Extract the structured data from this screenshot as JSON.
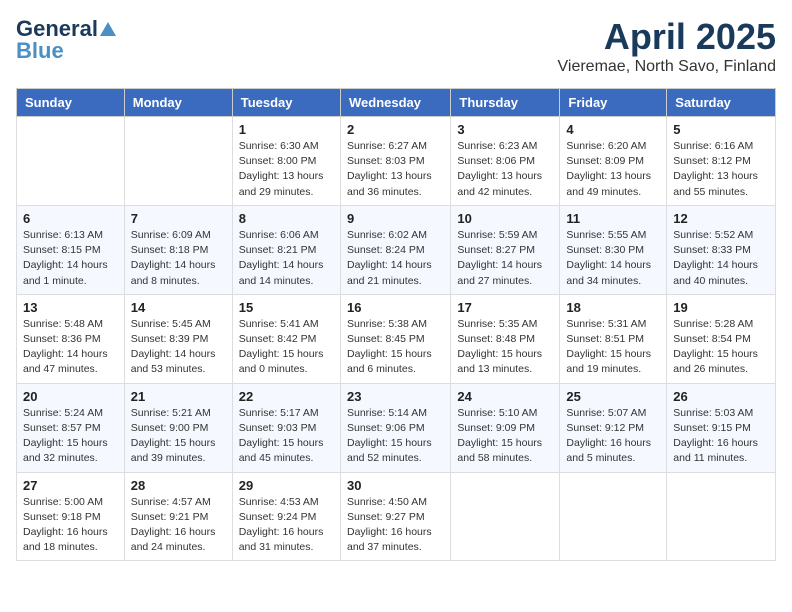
{
  "header": {
    "logo_general": "General",
    "logo_blue": "Blue",
    "month_title": "April 2025",
    "location": "Vieremae, North Savo, Finland"
  },
  "weekdays": [
    "Sunday",
    "Monday",
    "Tuesday",
    "Wednesday",
    "Thursday",
    "Friday",
    "Saturday"
  ],
  "weeks": [
    [
      {
        "day": "",
        "info": ""
      },
      {
        "day": "",
        "info": ""
      },
      {
        "day": "1",
        "info": "Sunrise: 6:30 AM\nSunset: 8:00 PM\nDaylight: 13 hours and 29 minutes."
      },
      {
        "day": "2",
        "info": "Sunrise: 6:27 AM\nSunset: 8:03 PM\nDaylight: 13 hours and 36 minutes."
      },
      {
        "day": "3",
        "info": "Sunrise: 6:23 AM\nSunset: 8:06 PM\nDaylight: 13 hours and 42 minutes."
      },
      {
        "day": "4",
        "info": "Sunrise: 6:20 AM\nSunset: 8:09 PM\nDaylight: 13 hours and 49 minutes."
      },
      {
        "day": "5",
        "info": "Sunrise: 6:16 AM\nSunset: 8:12 PM\nDaylight: 13 hours and 55 minutes."
      }
    ],
    [
      {
        "day": "6",
        "info": "Sunrise: 6:13 AM\nSunset: 8:15 PM\nDaylight: 14 hours and 1 minute."
      },
      {
        "day": "7",
        "info": "Sunrise: 6:09 AM\nSunset: 8:18 PM\nDaylight: 14 hours and 8 minutes."
      },
      {
        "day": "8",
        "info": "Sunrise: 6:06 AM\nSunset: 8:21 PM\nDaylight: 14 hours and 14 minutes."
      },
      {
        "day": "9",
        "info": "Sunrise: 6:02 AM\nSunset: 8:24 PM\nDaylight: 14 hours and 21 minutes."
      },
      {
        "day": "10",
        "info": "Sunrise: 5:59 AM\nSunset: 8:27 PM\nDaylight: 14 hours and 27 minutes."
      },
      {
        "day": "11",
        "info": "Sunrise: 5:55 AM\nSunset: 8:30 PM\nDaylight: 14 hours and 34 minutes."
      },
      {
        "day": "12",
        "info": "Sunrise: 5:52 AM\nSunset: 8:33 PM\nDaylight: 14 hours and 40 minutes."
      }
    ],
    [
      {
        "day": "13",
        "info": "Sunrise: 5:48 AM\nSunset: 8:36 PM\nDaylight: 14 hours and 47 minutes."
      },
      {
        "day": "14",
        "info": "Sunrise: 5:45 AM\nSunset: 8:39 PM\nDaylight: 14 hours and 53 minutes."
      },
      {
        "day": "15",
        "info": "Sunrise: 5:41 AM\nSunset: 8:42 PM\nDaylight: 15 hours and 0 minutes."
      },
      {
        "day": "16",
        "info": "Sunrise: 5:38 AM\nSunset: 8:45 PM\nDaylight: 15 hours and 6 minutes."
      },
      {
        "day": "17",
        "info": "Sunrise: 5:35 AM\nSunset: 8:48 PM\nDaylight: 15 hours and 13 minutes."
      },
      {
        "day": "18",
        "info": "Sunrise: 5:31 AM\nSunset: 8:51 PM\nDaylight: 15 hours and 19 minutes."
      },
      {
        "day": "19",
        "info": "Sunrise: 5:28 AM\nSunset: 8:54 PM\nDaylight: 15 hours and 26 minutes."
      }
    ],
    [
      {
        "day": "20",
        "info": "Sunrise: 5:24 AM\nSunset: 8:57 PM\nDaylight: 15 hours and 32 minutes."
      },
      {
        "day": "21",
        "info": "Sunrise: 5:21 AM\nSunset: 9:00 PM\nDaylight: 15 hours and 39 minutes."
      },
      {
        "day": "22",
        "info": "Sunrise: 5:17 AM\nSunset: 9:03 PM\nDaylight: 15 hours and 45 minutes."
      },
      {
        "day": "23",
        "info": "Sunrise: 5:14 AM\nSunset: 9:06 PM\nDaylight: 15 hours and 52 minutes."
      },
      {
        "day": "24",
        "info": "Sunrise: 5:10 AM\nSunset: 9:09 PM\nDaylight: 15 hours and 58 minutes."
      },
      {
        "day": "25",
        "info": "Sunrise: 5:07 AM\nSunset: 9:12 PM\nDaylight: 16 hours and 5 minutes."
      },
      {
        "day": "26",
        "info": "Sunrise: 5:03 AM\nSunset: 9:15 PM\nDaylight: 16 hours and 11 minutes."
      }
    ],
    [
      {
        "day": "27",
        "info": "Sunrise: 5:00 AM\nSunset: 9:18 PM\nDaylight: 16 hours and 18 minutes."
      },
      {
        "day": "28",
        "info": "Sunrise: 4:57 AM\nSunset: 9:21 PM\nDaylight: 16 hours and 24 minutes."
      },
      {
        "day": "29",
        "info": "Sunrise: 4:53 AM\nSunset: 9:24 PM\nDaylight: 16 hours and 31 minutes."
      },
      {
        "day": "30",
        "info": "Sunrise: 4:50 AM\nSunset: 9:27 PM\nDaylight: 16 hours and 37 minutes."
      },
      {
        "day": "",
        "info": ""
      },
      {
        "day": "",
        "info": ""
      },
      {
        "day": "",
        "info": ""
      }
    ]
  ]
}
